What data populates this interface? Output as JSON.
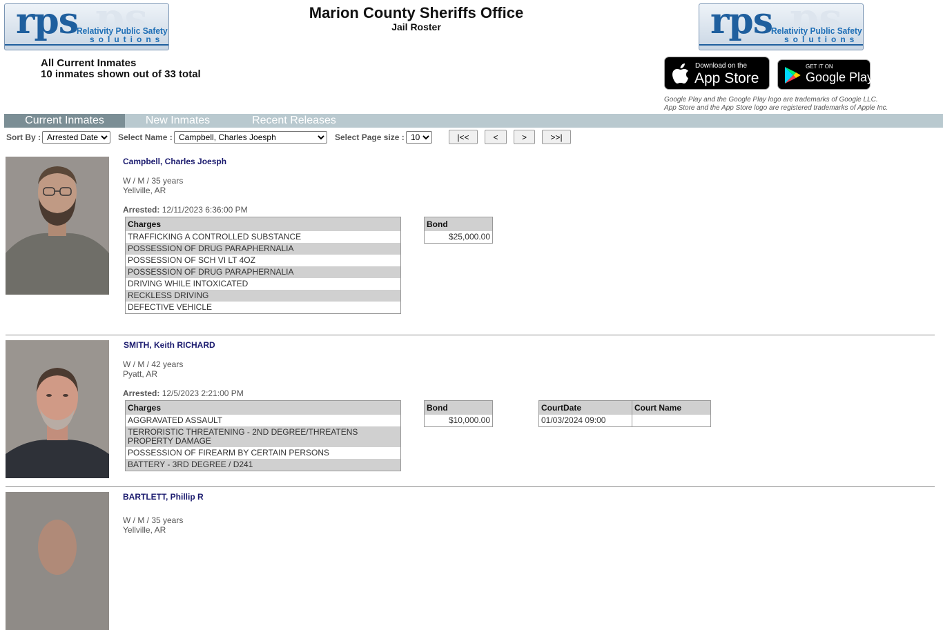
{
  "header": {
    "title": "Marion County Sheriffs Office",
    "subtitle": "Jail Roster",
    "summary_line1": "All Current Inmates",
    "summary_line2": "10 inmates shown out of 33 total",
    "logo": {
      "big": "rps",
      "ghost": "ps",
      "line1": "Relativity Public Safety",
      "line2": "solutions"
    }
  },
  "stores": {
    "apple_small": "Download on the",
    "apple_name": "App Store",
    "google_small": "GET IT ON",
    "google_name": "Google Play",
    "disclaimer1": "Google Play and the Google Play logo are trademarks of Google LLC.",
    "disclaimer2": "App Store and the App Store logo are registered trademarks of Apple Inc."
  },
  "tabs": [
    "Current Inmates",
    "New Inmates",
    "Recent Releases"
  ],
  "toolbar": {
    "sort_label": "Sort By :",
    "sort_value": "Arrested Date",
    "name_label": "Select Name :",
    "name_value": "Campbell, Charles Joesph",
    "pagesize_label": "Select Page size :",
    "pagesize_value": "10",
    "first": "|<<",
    "prev": "<",
    "next": ">",
    "last": ">>|"
  },
  "labels": {
    "arrested": "Arrested:",
    "charges": "Charges",
    "bond": "Bond",
    "court_date": "CourtDate",
    "court_name": "Court Name"
  },
  "inmates": [
    {
      "name": "Campbell, Charles Joesph",
      "demo": "W / M / 35 years",
      "city": "Yellville, AR",
      "arrested": "12/11/2023 6:36:00 PM",
      "charges": [
        "TRAFFICKING A CONTROLLED SUBSTANCE",
        "POSSESSION OF DRUG PARAPHERNALIA",
        "POSSESSION OF SCH VI LT 4OZ",
        "POSSESSION OF DRUG PARAPHERNALIA",
        "DRIVING WHILE INTOXICATED",
        "RECKLESS DRIVING",
        "DEFECTIVE VEHICLE"
      ],
      "bond": "$25,000.00"
    },
    {
      "name": "SMITH, Keith RICHARD",
      "demo": "W / M / 42 years",
      "city": "Pyatt, AR",
      "arrested": "12/5/2023 2:21:00 PM",
      "charges": [
        "AGGRAVATED ASSAULT",
        "TERRORISTIC THREATENING - 2ND DEGREE/THREATENS PROPERTY DAMAGE",
        "POSSESSION OF FIREARM BY CERTAIN PERSONS",
        "BATTERY - 3RD DEGREE / D241"
      ],
      "bond": "$10,000.00",
      "court_date": "01/03/2024 09:00",
      "court_name": ""
    },
    {
      "name": "BARTLETT, Phillip R",
      "demo": "W / M / 35 years",
      "city": "Yellville, AR"
    }
  ],
  "colors": {
    "tabbar": "#b9c9cf",
    "tab_active": "#7b8e95",
    "name": "#1a1a6e",
    "logo_blue": "#1f5f9e"
  }
}
